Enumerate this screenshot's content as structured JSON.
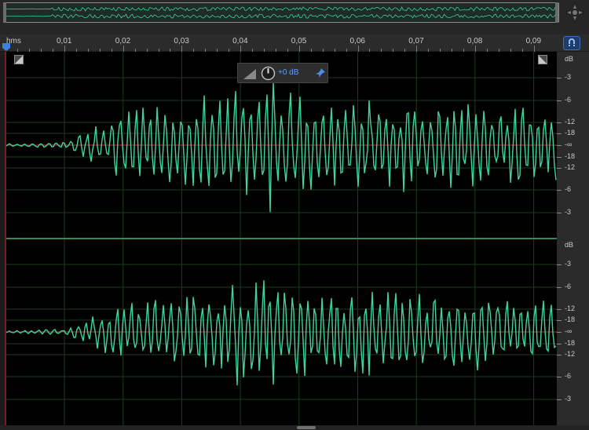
{
  "overview": {
    "label": "overview-waveform"
  },
  "ruler": {
    "unit_label": "hms",
    "ticks": [
      "0,01",
      "0,02",
      "0,03",
      "0,04",
      "0,05",
      "0,06",
      "0,07",
      "0,08",
      "0,09"
    ]
  },
  "hud": {
    "gain_value": "+0 dB"
  },
  "db_scale": {
    "unit_top": "dB",
    "unit_bottom": "dB",
    "channel_labels": [
      "-3",
      "-6",
      "-12",
      "-18",
      "-∞",
      "-18",
      "-12",
      "-6",
      "-3"
    ]
  },
  "colors": {
    "waveform": "#3ed49b",
    "centerline": "#b83232",
    "grid": "#1e3a1e",
    "separator": "#2f8a4f",
    "accent": "#3b6fb5"
  },
  "icons": {
    "zoom_navigator": "zoom-navigator-icon",
    "snap": "snap-magnet-icon",
    "pin": "pin-icon",
    "level": "level-meter-icon",
    "knob": "gain-knob-icon",
    "fade_in": "fade-in-icon",
    "fade_out": "fade-out-icon"
  }
}
